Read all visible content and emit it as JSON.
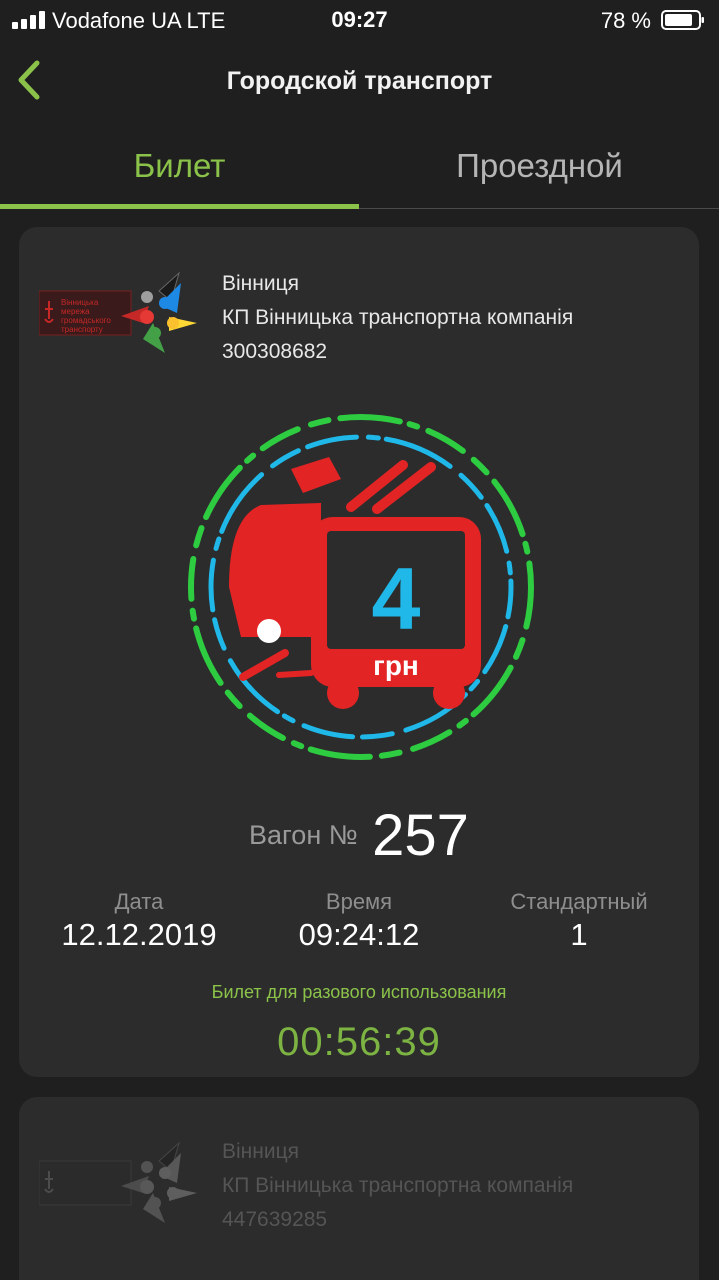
{
  "status_bar": {
    "carrier": "Vodafone UA   LTE",
    "time": "09:27",
    "battery": "78 %"
  },
  "nav": {
    "title": "Городской транспорт",
    "back_icon": "chevron-left-icon"
  },
  "tabs": [
    {
      "label": "Билет",
      "active": true
    },
    {
      "label": "Проездной",
      "active": false
    }
  ],
  "colors": {
    "accent": "#8bc34a",
    "badge_red": "#e32424",
    "badge_cyan": "#1fb8e8",
    "badge_green": "#2ecc40"
  },
  "tickets": [
    {
      "city": "Вінниця",
      "company": "КП Вінницька транспортна компанія",
      "id": "300308682",
      "price_value": "4",
      "price_unit": "грн",
      "wagon_label": "Вагон №",
      "wagon_number": "257",
      "date_label": "Дата",
      "date_value": "12.12.2019",
      "time_label": "Время",
      "time_value": "09:24:12",
      "type_label": "Стандартный",
      "type_value": "1",
      "usage_note": "Билет для разового использования",
      "timer": "00:56:39"
    },
    {
      "city": "Вінниця",
      "company": "КП Вінницька транспортна компанія",
      "id": "447639285"
    }
  ]
}
